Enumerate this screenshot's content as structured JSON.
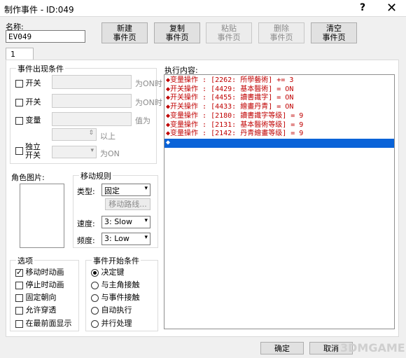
{
  "window": {
    "title": "制作事件 - ID:049",
    "help": "?",
    "close": "✕"
  },
  "name": {
    "label": "名称:",
    "value": "EV049"
  },
  "toolbar": [
    {
      "line1": "新建",
      "line2": "事件页",
      "enabled": true
    },
    {
      "line1": "复制",
      "line2": "事件页",
      "enabled": true
    },
    {
      "line1": "粘贴",
      "line2": "事件页",
      "enabled": false
    },
    {
      "line1": "删除",
      "line2": "事件页",
      "enabled": false
    },
    {
      "line1": "清空",
      "line2": "事件页",
      "enabled": true
    }
  ],
  "tab": {
    "label": "1"
  },
  "conditions": {
    "title": "事件出现条件",
    "switch1": {
      "label": "开关",
      "suffix": "为ON时"
    },
    "switch2": {
      "label": "开关",
      "suffix": "为ON时"
    },
    "variable": {
      "label": "变量",
      "suffix": "值为",
      "above": "以上"
    },
    "self_switch": {
      "label_line1": "独立",
      "label_line2": "开关",
      "suffix": "为ON"
    }
  },
  "graphic": {
    "label": "角色图片:"
  },
  "movement": {
    "title": "移动规则",
    "type_label": "类型:",
    "type_value": "固定",
    "route_button": "移动路线...",
    "speed_label": "速度:",
    "speed_value": "3: Slow",
    "freq_label": "频度:",
    "freq_value": "3: Low"
  },
  "options": {
    "title": "选项",
    "items": [
      {
        "label": "移动时动画",
        "checked": true
      },
      {
        "label": "停止时动画",
        "checked": false
      },
      {
        "label": "固定朝向",
        "checked": false
      },
      {
        "label": "允许穿透",
        "checked": false
      },
      {
        "label": "在最前面显示",
        "checked": false
      }
    ]
  },
  "trigger": {
    "title": "事件开始条件",
    "items": [
      {
        "label": "决定键",
        "checked": true
      },
      {
        "label": "与主角接触",
        "checked": false
      },
      {
        "label": "与事件接触",
        "checked": false
      },
      {
        "label": "自动执行",
        "checked": false
      },
      {
        "label": "并行处理",
        "checked": false
      }
    ]
  },
  "contents": {
    "label": "执行内容:",
    "lines": [
      "◆变量操作 : [2262: 所學藝術] += 3",
      "◆开关操作 : [4429: 基本醫術] = ON",
      "◆开关操作 : [4455: 讀書識字] = ON",
      "◆开关操作 : [4433: 繪畫丹青] = ON",
      "◆变量操作 : [2180: 讀書識字等级] = 9",
      "◆变量操作 : [2131: 基本醫術等级] = 9",
      "◆变量操作 : [2142: 丹青繪畫等级] = 9"
    ],
    "selected_line": "◆"
  },
  "footer": {
    "ok": "确定",
    "cancel": "取消",
    "watermark": "3DMGAME"
  }
}
